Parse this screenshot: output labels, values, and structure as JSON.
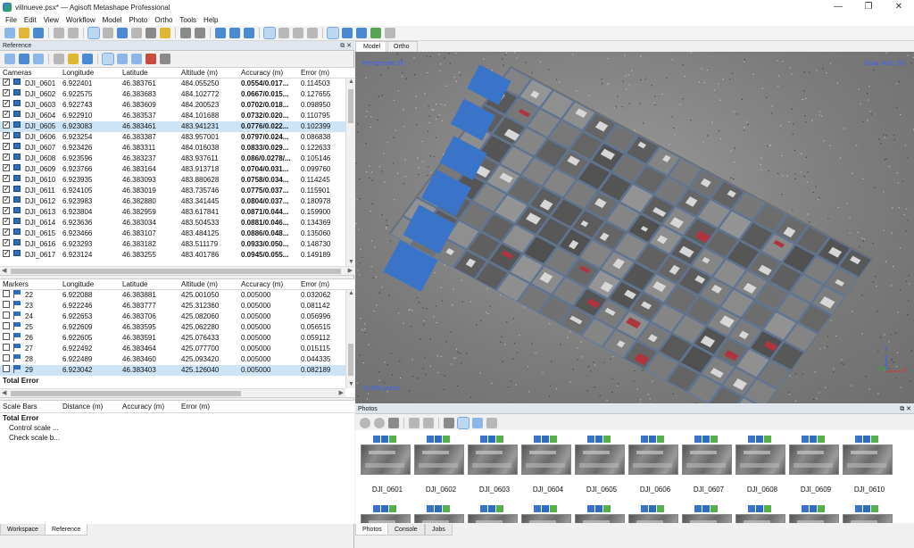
{
  "window": {
    "title": "villnueve.psx* — Agisoft Metashape Professional",
    "minimize": "—",
    "maximize": "❐",
    "close": "✕"
  },
  "menu": [
    "File",
    "Edit",
    "View",
    "Workflow",
    "Model",
    "Photo",
    "Ortho",
    "Tools",
    "Help"
  ],
  "reference_panel": {
    "title": "Reference",
    "dock_controls": "⧉ ✕",
    "cameras": {
      "headers": [
        "Cameras",
        "Longitude",
        "Latitude",
        "Altitude (m)",
        "Accuracy (m)",
        "Error (m)"
      ],
      "rows": [
        {
          "name": "DJI_0601",
          "lon": "6.922401",
          "lat": "46.383761",
          "alt": "484.055250",
          "acc": "0.0554/0.017...",
          "err": "0.114503",
          "checked": true
        },
        {
          "name": "DJI_0602",
          "lon": "6.922575",
          "lat": "46.383683",
          "alt": "484.102772",
          "acc": "0.0667/0.015...",
          "err": "0.127655",
          "checked": true
        },
        {
          "name": "DJI_0603",
          "lon": "6.922743",
          "lat": "46.383609",
          "alt": "484.200523",
          "acc": "0.0702/0.018...",
          "err": "0.098950",
          "checked": true
        },
        {
          "name": "DJI_0604",
          "lon": "6.922910",
          "lat": "46.383537",
          "alt": "484.101688",
          "acc": "0.0732/0.020...",
          "err": "0.110795",
          "checked": true
        },
        {
          "name": "DJI_0605",
          "lon": "6.923083",
          "lat": "46.383461",
          "alt": "483.941231",
          "acc": "0.0776/0.022...",
          "err": "0.102399",
          "checked": true,
          "selected": true
        },
        {
          "name": "DJI_0606",
          "lon": "6.923254",
          "lat": "46.383387",
          "alt": "483.957001",
          "acc": "0.0797/0.024...",
          "err": "0.086838",
          "checked": true
        },
        {
          "name": "DJI_0607",
          "lon": "6.923426",
          "lat": "46.383311",
          "alt": "484.016038",
          "acc": "0.0833/0.029...",
          "err": "0.122633",
          "checked": true
        },
        {
          "name": "DJI_0608",
          "lon": "6.923596",
          "lat": "46.383237",
          "alt": "483.937611",
          "acc": "0.086/0.0278/...",
          "err": "0.105146",
          "checked": true
        },
        {
          "name": "DJI_0609",
          "lon": "6.923766",
          "lat": "46.383164",
          "alt": "483.913718",
          "acc": "0.0704/0.031...",
          "err": "0.099760",
          "checked": true
        },
        {
          "name": "DJI_0610",
          "lon": "6.923935",
          "lat": "46.383093",
          "alt": "483.880628",
          "acc": "0.0758/0.034...",
          "err": "0.114245",
          "checked": true
        },
        {
          "name": "DJI_0611",
          "lon": "6.924105",
          "lat": "46.383019",
          "alt": "483.735746",
          "acc": "0.0775/0.037...",
          "err": "0.115901",
          "checked": true
        },
        {
          "name": "DJI_0612",
          "lon": "6.923983",
          "lat": "46.382880",
          "alt": "483.341445",
          "acc": "0.0804/0.037...",
          "err": "0.180978",
          "checked": true
        },
        {
          "name": "DJI_0613",
          "lon": "6.923804",
          "lat": "46.382959",
          "alt": "483.617841",
          "acc": "0.0871/0.044...",
          "err": "0.159900",
          "checked": true
        },
        {
          "name": "DJI_0614",
          "lon": "6.923636",
          "lat": "46.383034",
          "alt": "483.504533",
          "acc": "0.0881/0.046...",
          "err": "0.134369",
          "checked": true
        },
        {
          "name": "DJI_0615",
          "lon": "6.923466",
          "lat": "46.383107",
          "alt": "483.484125",
          "acc": "0.0886/0.048...",
          "err": "0.135060",
          "checked": true
        },
        {
          "name": "DJI_0616",
          "lon": "6.923293",
          "lat": "46.383182",
          "alt": "483.511179",
          "acc": "0.0933/0.050...",
          "err": "0.148730",
          "checked": true
        },
        {
          "name": "DJI_0617",
          "lon": "6.923124",
          "lat": "46.383255",
          "alt": "483.401786",
          "acc": "0.0945/0.055...",
          "err": "0.149189",
          "checked": true
        }
      ]
    },
    "markers": {
      "headers": [
        "Markers",
        "Longitude",
        "Latitude",
        "Altitude (m)",
        "Accuracy (m)",
        "Error (m)"
      ],
      "rows": [
        {
          "name": "22",
          "lon": "6.922088",
          "lat": "46.383881",
          "alt": "425.001050",
          "acc": "0.005000",
          "err": "0.032062"
        },
        {
          "name": "23",
          "lon": "6.922246",
          "lat": "46.383777",
          "alt": "425.312360",
          "acc": "0.005000",
          "err": "0.081142"
        },
        {
          "name": "24",
          "lon": "6.922653",
          "lat": "46.383706",
          "alt": "425.082060",
          "acc": "0.005000",
          "err": "0.056996"
        },
        {
          "name": "25",
          "lon": "6.922609",
          "lat": "46.383595",
          "alt": "425.062280",
          "acc": "0.005000",
          "err": "0.056515"
        },
        {
          "name": "26",
          "lon": "6.922605",
          "lat": "46.383591",
          "alt": "425.076433",
          "acc": "0.005000",
          "err": "0.059112"
        },
        {
          "name": "27",
          "lon": "6.922492",
          "lat": "46.383464",
          "alt": "425.077700",
          "acc": "0.005000",
          "err": "0.015115"
        },
        {
          "name": "28",
          "lon": "6.922489",
          "lat": "46.383460",
          "alt": "425.093420",
          "acc": "0.005000",
          "err": "0.044335"
        },
        {
          "name": "29",
          "lon": "6.923042",
          "lat": "46.383403",
          "alt": "425.126040",
          "acc": "0.005000",
          "err": "0.082189",
          "selected": true
        }
      ],
      "total_label": "Total Error"
    },
    "scale_bars": {
      "headers": [
        "Scale Bars",
        "Distance (m)",
        "Accuracy (m)",
        "Error (m)"
      ],
      "total_label": "Total Error",
      "items": [
        "Control scale ...",
        "Check scale b..."
      ]
    }
  },
  "left_tabs": [
    "Workspace",
    "Reference"
  ],
  "model_view": {
    "tabs": [
      "Model",
      "Ortho"
    ],
    "perspective": "Perspective 30°",
    "snap": "Snap: Axis, 3D",
    "points": "11,045 points",
    "axis_y": "Y",
    "axis_z": "Z",
    "axis_x": "X"
  },
  "photos_panel": {
    "title": "Photos",
    "dock_controls": "⧉ ✕",
    "thumbnails": [
      "DJI_0601",
      "DJI_0602",
      "DJI_0603",
      "DJI_0604",
      "DJI_0605",
      "DJI_0606",
      "DJI_0607",
      "DJI_0608",
      "DJI_0609",
      "DJI_0610"
    ]
  },
  "bottom_tabs": [
    "Photos",
    "Console",
    "Jobs"
  ],
  "colors": {
    "camera_blue": "#3a74c9",
    "selection": "#cde4f7",
    "viewport_text": "#3a66ff"
  }
}
